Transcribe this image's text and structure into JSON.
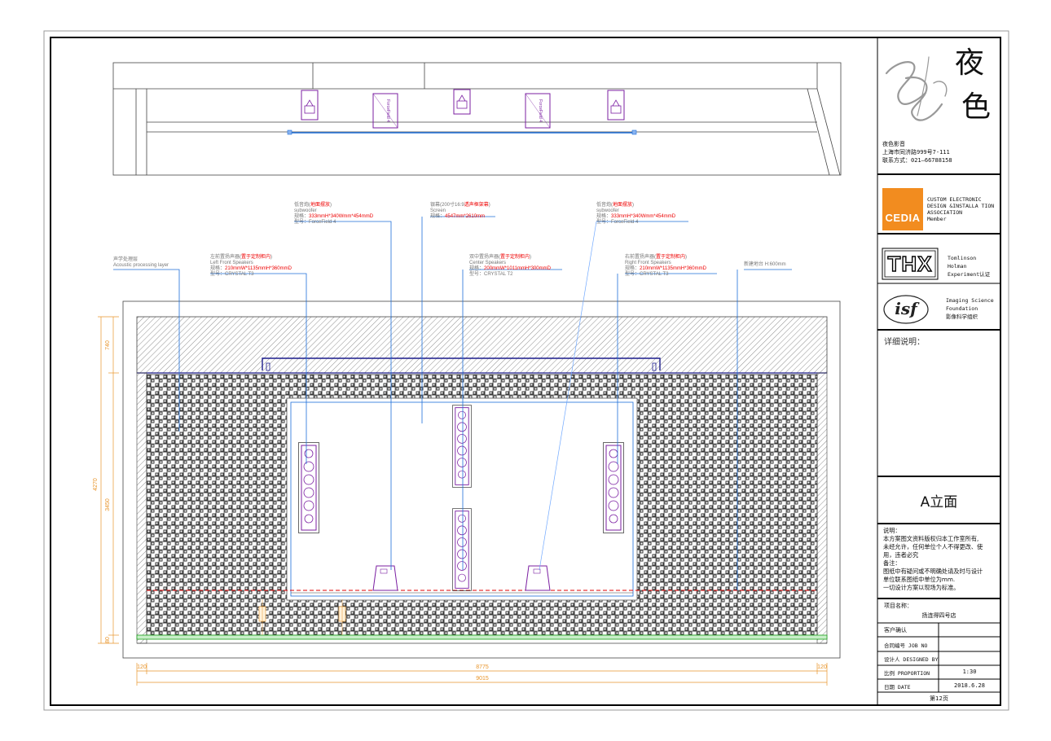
{
  "title_block": {
    "logo_chars": [
      "夜",
      "色"
    ],
    "company_name": "夜色影音",
    "address": "上海市同济路999号7-111",
    "contact": "联系方式：021—66788158",
    "cedia": {
      "badge": "CEDIA",
      "text_lines": [
        "CUSTOM ELECTRONIC",
        "DESIGN &INSTALLA TION",
        "ASSOCIATION",
        "Member"
      ]
    },
    "thx": {
      "badge": "THX",
      "text_lines": [
        "Tomlinson",
        "Holman",
        "Experiment认证"
      ]
    },
    "isf": {
      "badge": "isf",
      "text_lines": [
        "Imaging Science",
        "Foundation",
        "影像科学组织"
      ]
    },
    "detail_label": "详细说明：",
    "view_name": "A立面",
    "notes": [
      "说明：",
      "本方案图文资料版权归本工作室所有,",
      "未经允许，任何单位个人不得更改、使",
      "用，违者必究",
      "备注：",
      "图纸中有疑问或不明确处请及时与设计",
      "单位联系图纸中单位为mm.",
      "一切设计方案以现场为标准。"
    ],
    "project_label": "项目名称：",
    "project_name": "扬连得四号店",
    "client_confirm": "客户确认",
    "job_no_label": "合同编号  JOB NO",
    "designer_label": "设计人 DESIGNED BY",
    "proportion_label": "比例  PROPORTION",
    "proportion_value": "1:30",
    "date_label": "日期    DATE",
    "date_value": "2018.6.28",
    "page": "第12页"
  },
  "top_view": {
    "forcefield_label": "ForceField 4"
  },
  "annotations": {
    "acoustic": {
      "cn": "声学处理层",
      "en": "Acoustic processing layer"
    },
    "left_front": {
      "cn": "左前置扬声器(",
      "cn_red": "置于定制柜内",
      "cn_end": ")",
      "en": "Left Front Speakers",
      "spec_label": "规格：",
      "spec": "210mmW*1135mmH*360mmD",
      "model": "型号：CRYSTAL T3"
    },
    "sub_left": {
      "cn": "低音炮(",
      "cn_red": "地面摆放",
      "cn_end": ")",
      "en": "subwoofer",
      "spec_label": "规格：",
      "spec": "333mmH*340Wmm*454mmD",
      "model": "型号：ForceField 4"
    },
    "screen": {
      "cn": "银幕(200寸16:9",
      "cn_red": "透声框架幕",
      "cn_end": ")",
      "en": "Screen",
      "spec_label": "规格：",
      "spec": "4547mm*2610mm"
    },
    "center": {
      "cn": "双中置扬声器(",
      "cn_red": "置于定制柜内",
      "cn_end": ")",
      "en": "Center Speakers",
      "spec_label": "规格：",
      "spec": "200mmW*1011mmH*300mmD",
      "model": "型号：CRYSTAL T2"
    },
    "sub_right": {
      "cn": "低音炮(",
      "cn_red": "地面摆放",
      "cn_end": ")",
      "en": "subwoofer",
      "spec_label": "规格：",
      "spec": "333mmH*340Wmm*454mmD",
      "model": "型号：ForceField 4"
    },
    "right_front": {
      "cn": "右前置扬声器(",
      "cn_red": "置于定制柜内",
      "cn_end": ")",
      "en": "Right Front Speakers",
      "spec_label": "规格：",
      "spec": "210mmW*1135mmH*360mmD",
      "model": "型号：CRYSTAL T3"
    },
    "stage": {
      "cn": "新建地台 H:600mm"
    }
  },
  "dimensions": {
    "d740": "740",
    "d4270": "4270",
    "d3450": "3450",
    "d80": "80",
    "d120l": "120",
    "d8775": "8775",
    "d120r": "120",
    "d9015": "9015"
  },
  "colors": {
    "blue": "#1e6fd9",
    "purple": "#7b1fa2",
    "navy": "#1c1c8c",
    "red": "#e00000",
    "orange": "#e8952b",
    "green": "#1aa01a"
  }
}
